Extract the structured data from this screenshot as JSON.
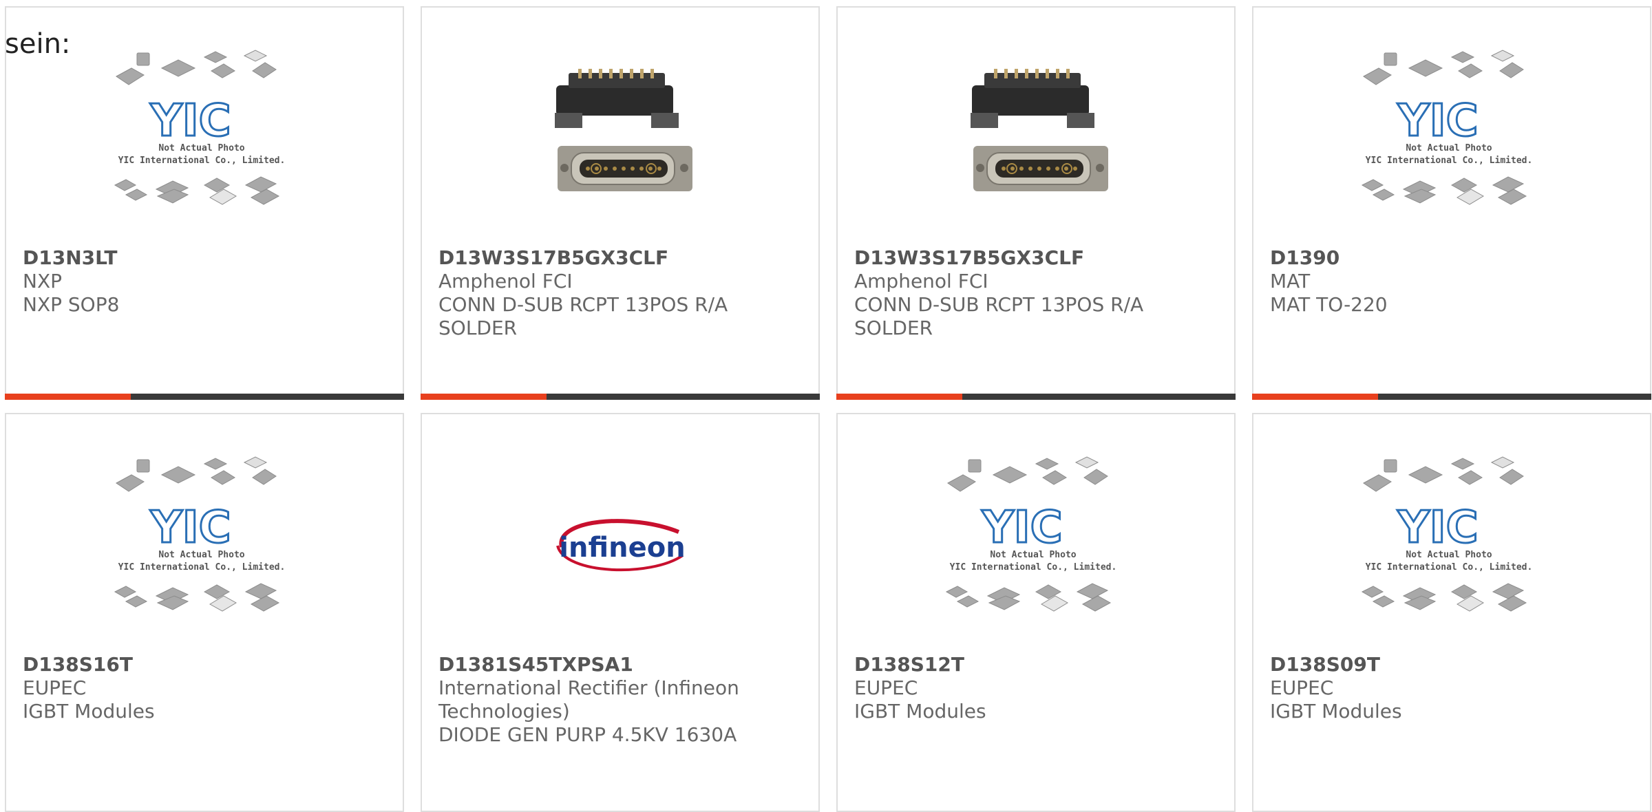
{
  "top_label": "sein:",
  "placeholder": {
    "line1": "Not Actual Photo",
    "line2": "YIC International Co., Limited.",
    "brand": "YIC"
  },
  "infineon_logo_text": "infineon",
  "colors": {
    "accent": "#e8401e",
    "bar": "#3a3a3a",
    "yic_blue": "#2a6fb5",
    "infineon_red": "#c8102e",
    "infineon_blue": "#1b3f91"
  },
  "products": [
    {
      "part_number": "D13N3LT",
      "manufacturer": "NXP",
      "description": "NXP SOP8",
      "image": "yic-placeholder"
    },
    {
      "part_number": "D13W3S17B5GX3CLF",
      "manufacturer": "Amphenol FCI",
      "description": "CONN D-SUB RCPT 13POS R/A SOLDER",
      "image": "dsub-connector"
    },
    {
      "part_number": "D13W3S17B5GX3CLF",
      "manufacturer": "Amphenol FCI",
      "description": "CONN D-SUB RCPT 13POS R/A SOLDER",
      "image": "dsub-connector"
    },
    {
      "part_number": "D1390",
      "manufacturer": "MAT",
      "description": "MAT TO-220",
      "image": "yic-placeholder"
    },
    {
      "part_number": "D138S16T",
      "manufacturer": "EUPEC",
      "description": "IGBT Modules",
      "image": "yic-placeholder"
    },
    {
      "part_number": "D1381S45TXPSA1",
      "manufacturer": "International Rectifier (Infineon Technologies)",
      "description": "DIODE GEN PURP 4.5KV 1630A",
      "image": "infineon-logo"
    },
    {
      "part_number": "D138S12T",
      "manufacturer": "EUPEC",
      "description": "IGBT Modules",
      "image": "yic-placeholder"
    },
    {
      "part_number": "D138S09T",
      "manufacturer": "EUPEC",
      "description": "IGBT Modules",
      "image": "yic-placeholder"
    }
  ]
}
